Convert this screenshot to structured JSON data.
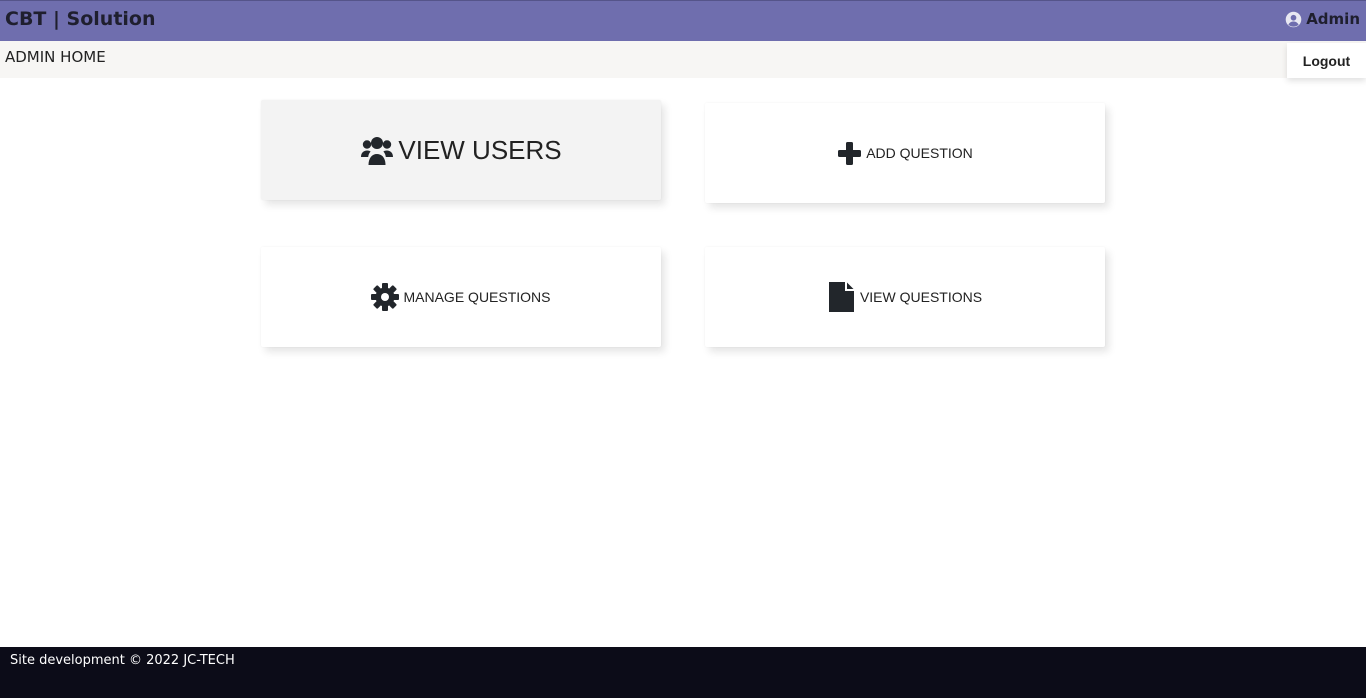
{
  "header": {
    "brand": "CBT | Solution",
    "user_icon": "user-circle-icon",
    "user_label": "Admin"
  },
  "subheader": {
    "title": "ADMIN HOME",
    "logout_label": "Logout"
  },
  "cards": [
    {
      "label": "VIEW USERS",
      "icon": "users-icon"
    },
    {
      "label": "ADD QUESTION",
      "icon": "plus-icon"
    },
    {
      "label": "MANAGE QUESTIONS",
      "icon": "gear-icon"
    },
    {
      "label": "VIEW QUESTIONS",
      "icon": "file-icon"
    }
  ],
  "footer": {
    "text": "Site development © 2022 JC-TECH"
  },
  "colors": {
    "header_bg": "#6f6eae",
    "subheader_bg": "#f7f6f4",
    "footer_bg": "#0c0c18",
    "icon": "#22262b"
  }
}
